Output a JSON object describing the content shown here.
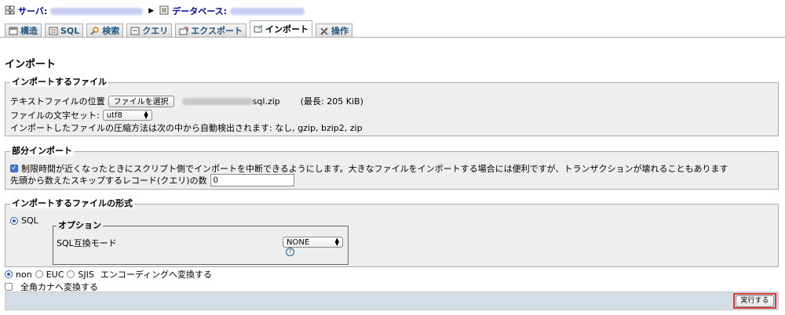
{
  "breadcrumb": {
    "server_label": "サーバ:",
    "database_label": "データベース:"
  },
  "tabs": [
    {
      "label": "構造",
      "icon": "structure-icon"
    },
    {
      "label": "SQL",
      "icon": "sql-icon"
    },
    {
      "label": "検索",
      "icon": "search-icon"
    },
    {
      "label": "クエリ",
      "icon": "query-icon"
    },
    {
      "label": "エクスポート",
      "icon": "export-icon"
    },
    {
      "label": "インポート",
      "icon": "import-icon",
      "active": true
    },
    {
      "label": "操作",
      "icon": "operations-icon"
    }
  ],
  "page_title": "インポート",
  "file_section": {
    "legend": "インポートするファイル",
    "file_location_label": "テキストファイルの位置",
    "choose_file_button": "ファイルを選択",
    "file_name_suffix": "sql.zip",
    "max_size": "(最長: 205 KiB)",
    "charset_label": "ファイルの文字セット:",
    "charset_value": "utf8",
    "compression_note": "インポートしたファイルの圧縮方法は次の中から自動検出されます: なし, gzip, bzip2, zip"
  },
  "partial_section": {
    "legend": "部分インポート",
    "interrupt_checkbox_label": "制限時間が近くなったときにスクリプト側でインポートを中断できるようにします。大きなファイルをインポートする場合には便利ですが、トランザクションが壊れることもあります",
    "interrupt_checked": true,
    "skip_label": "先頭から数えたスキップするレコード(クエリ)の数",
    "skip_value": "0"
  },
  "format_section": {
    "legend": "インポートするファイルの形式",
    "format_option": "SQL",
    "options_legend": "オプション",
    "compat_label": "SQL互換モード",
    "compat_value": "NONE",
    "help_icon": "help-icon"
  },
  "encoding": {
    "options": [
      "non",
      "EUC",
      "SJIS"
    ],
    "selected": "non",
    "convert_label": "エンコーディングへ変換する",
    "kana_label": "全角カナへ変換する",
    "kana_checked": false
  },
  "footer": {
    "execute_button": "実行する"
  }
}
